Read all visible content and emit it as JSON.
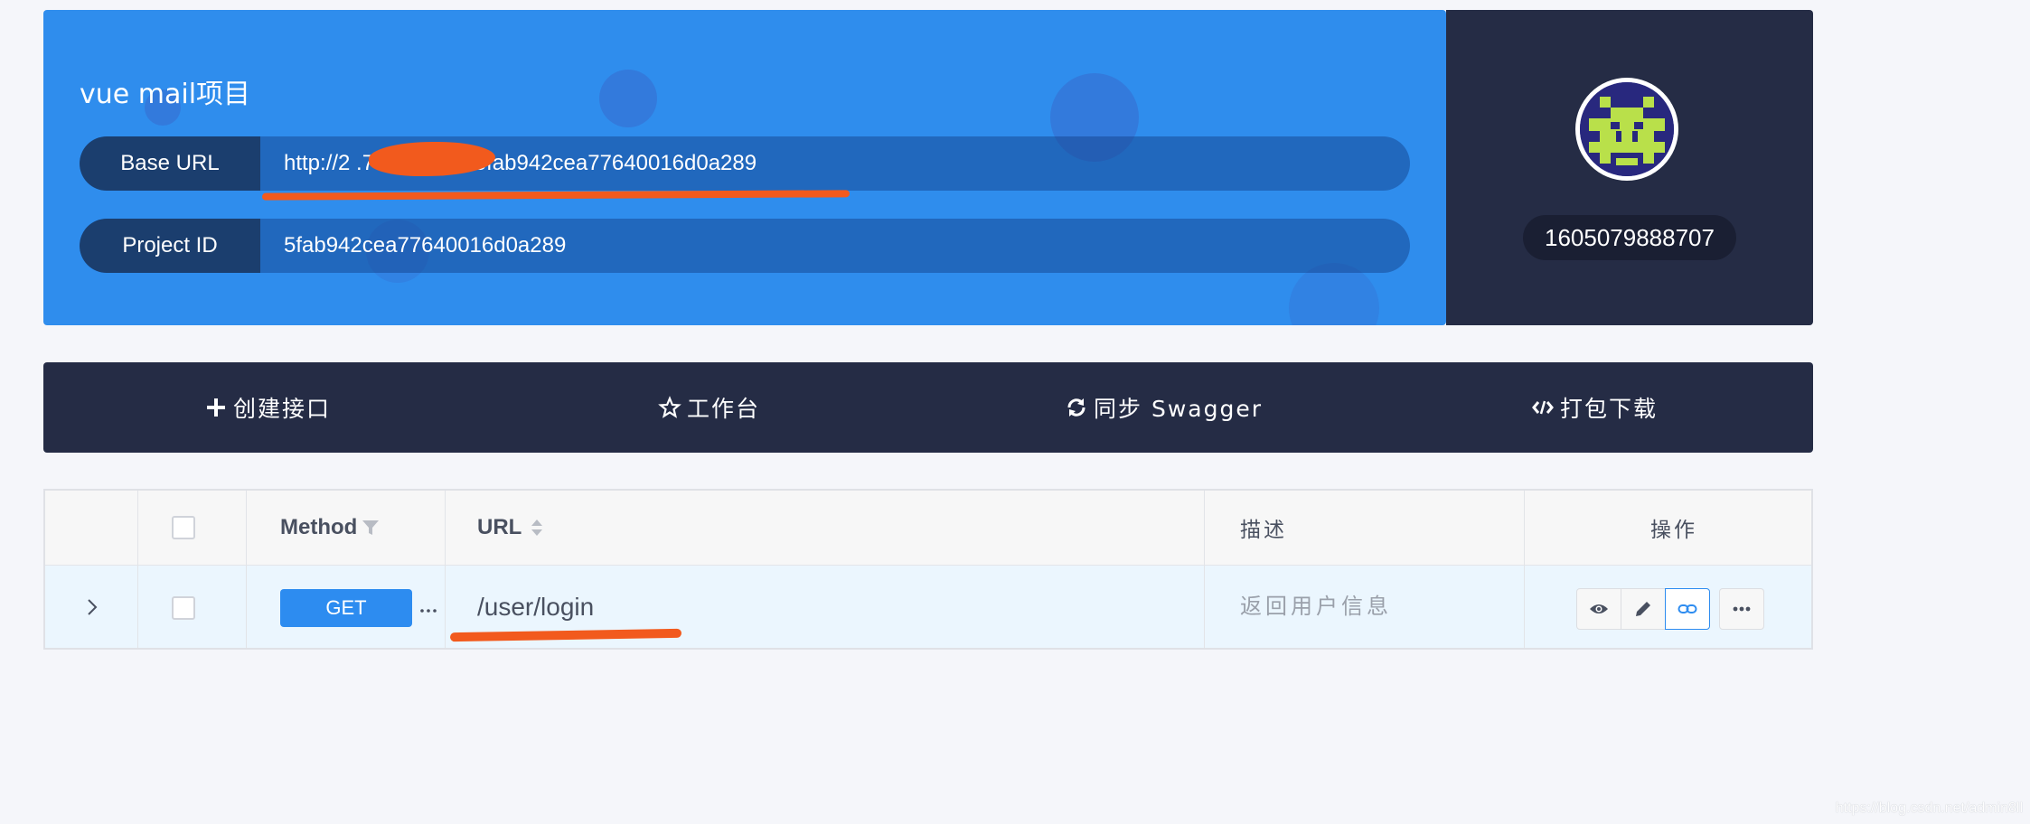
{
  "project": {
    "title": "vue mail项目",
    "base_url_label": "Base URL",
    "base_url_value": "http://2 .7300/mock/5fab942cea77640016d0a289",
    "project_id_label": "Project ID",
    "project_id_value": "5fab942cea77640016d0a289",
    "accent_color": "#2f8ded"
  },
  "user": {
    "id": "1605079888707"
  },
  "toolbar": {
    "create": "创建接口",
    "workbench": "工作台",
    "sync": "同步 Swagger",
    "download": "打包下载"
  },
  "table": {
    "headers": {
      "method": "Method",
      "url": "URL",
      "description": "描述",
      "actions": "操作"
    },
    "rows": [
      {
        "method": "GET",
        "url": "/user/login",
        "description": "返回用户信息"
      }
    ]
  },
  "icons": {
    "create": "plus-icon",
    "workbench": "star-icon",
    "sync": "refresh-icon",
    "download": "code-icon",
    "view": "eye-icon",
    "edit": "pencil-icon",
    "copy_link": "link-icon",
    "more": "ellipsis-icon"
  },
  "watermark": "https://blog.csdn.net/admin8ll"
}
